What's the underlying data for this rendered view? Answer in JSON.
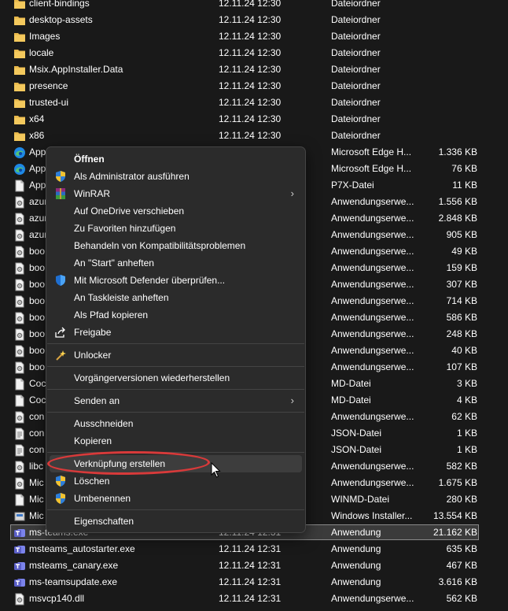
{
  "files": [
    {
      "name": "client-bindings",
      "date": "12.11.24 12:30",
      "type": "Dateiordner",
      "size": "",
      "icon": "folder-icon"
    },
    {
      "name": "desktop-assets",
      "date": "12.11.24 12:30",
      "type": "Dateiordner",
      "size": "",
      "icon": "folder-icon"
    },
    {
      "name": "Images",
      "date": "12.11.24 12:30",
      "type": "Dateiordner",
      "size": "",
      "icon": "folder-icon"
    },
    {
      "name": "locale",
      "date": "12.11.24 12:30",
      "type": "Dateiordner",
      "size": "",
      "icon": "folder-icon"
    },
    {
      "name": "Msix.AppInstaller.Data",
      "date": "12.11.24 12:30",
      "type": "Dateiordner",
      "size": "",
      "icon": "folder-icon"
    },
    {
      "name": "presence",
      "date": "12.11.24 12:30",
      "type": "Dateiordner",
      "size": "",
      "icon": "folder-icon"
    },
    {
      "name": "trusted-ui",
      "date": "12.11.24 12:30",
      "type": "Dateiordner",
      "size": "",
      "icon": "folder-icon"
    },
    {
      "name": "x64",
      "date": "12.11.24 12:30",
      "type": "Dateiordner",
      "size": "",
      "icon": "folder-icon"
    },
    {
      "name": "x86",
      "date": "12.11.24 12:30",
      "type": "Dateiordner",
      "size": "",
      "icon": "folder-icon"
    },
    {
      "name": "App",
      "date": "",
      "type": "Microsoft Edge H...",
      "size": "1.336 KB",
      "icon": "edge-icon"
    },
    {
      "name": "App",
      "date": "",
      "type": "Microsoft Edge H...",
      "size": "76 KB",
      "icon": "edge-icon"
    },
    {
      "name": "App",
      "date": "",
      "type": "P7X-Datei",
      "size": "11 KB",
      "icon": "file-icon"
    },
    {
      "name": "azur",
      "date": "",
      "type": "Anwendungserwe...",
      "size": "1.556 KB",
      "icon": "dll-icon"
    },
    {
      "name": "azur",
      "date": "",
      "type": "Anwendungserwe...",
      "size": "2.848 KB",
      "icon": "dll-icon"
    },
    {
      "name": "azur",
      "date": "",
      "type": "Anwendungserwe...",
      "size": "905 KB",
      "icon": "dll-icon"
    },
    {
      "name": "boo",
      "date": "",
      "type": "Anwendungserwe...",
      "size": "49 KB",
      "icon": "dll-icon"
    },
    {
      "name": "boo",
      "date": "",
      "type": "Anwendungserwe...",
      "size": "159 KB",
      "icon": "dll-icon"
    },
    {
      "name": "boo",
      "date": "",
      "type": "Anwendungserwe...",
      "size": "307 KB",
      "icon": "dll-icon"
    },
    {
      "name": "boo",
      "date": "",
      "type": "Anwendungserwe...",
      "size": "714 KB",
      "icon": "dll-icon"
    },
    {
      "name": "boo",
      "date": "",
      "type": "Anwendungserwe...",
      "size": "586 KB",
      "icon": "dll-icon"
    },
    {
      "name": "boo",
      "date": "",
      "type": "Anwendungserwe...",
      "size": "248 KB",
      "icon": "dll-icon"
    },
    {
      "name": "boo",
      "date": "",
      "type": "Anwendungserwe...",
      "size": "40 KB",
      "icon": "dll-icon"
    },
    {
      "name": "boo",
      "date": "",
      "type": "Anwendungserwe...",
      "size": "107 KB",
      "icon": "dll-icon"
    },
    {
      "name": "Coc",
      "date": "",
      "type": "MD-Datei",
      "size": "3 KB",
      "icon": "file-icon"
    },
    {
      "name": "Coc",
      "date": "",
      "type": "MD-Datei",
      "size": "4 KB",
      "icon": "file-icon"
    },
    {
      "name": "con",
      "date": "",
      "type": "Anwendungserwe...",
      "size": "62 KB",
      "icon": "dll-icon"
    },
    {
      "name": "con",
      "date": "",
      "type": "JSON-Datei",
      "size": "1 KB",
      "icon": "text-file-icon"
    },
    {
      "name": "con",
      "date": "",
      "type": "JSON-Datei",
      "size": "1 KB",
      "icon": "text-file-icon"
    },
    {
      "name": "libc",
      "date": "",
      "type": "Anwendungserwe...",
      "size": "582 KB",
      "icon": "dll-icon"
    },
    {
      "name": "Mic",
      "date": "",
      "type": "Anwendungserwe...",
      "size": "1.675 KB",
      "icon": "dll-icon"
    },
    {
      "name": "Mic",
      "date": "",
      "type": "WINMD-Datei",
      "size": "280 KB",
      "icon": "file-icon"
    },
    {
      "name": "Mic",
      "date": "",
      "type": "Windows Installer...",
      "size": "13.554 KB",
      "icon": "installer-icon"
    },
    {
      "name": "ms-teams.exe",
      "date": "12.11.24 12:31",
      "type": "Anwendung",
      "size": "21.162 KB",
      "icon": "teams-icon",
      "selected": true
    },
    {
      "name": "msteams_autostarter.exe",
      "date": "12.11.24 12:31",
      "type": "Anwendung",
      "size": "635 KB",
      "icon": "teams-icon"
    },
    {
      "name": "msteams_canary.exe",
      "date": "12.11.24 12:31",
      "type": "Anwendung",
      "size": "467 KB",
      "icon": "teams-icon"
    },
    {
      "name": "ms-teamsupdate.exe",
      "date": "12.11.24 12:31",
      "type": "Anwendung",
      "size": "3.616 KB",
      "icon": "teams-icon"
    },
    {
      "name": "msvcp140.dll",
      "date": "12.11.24 12:31",
      "type": "Anwendungserwe...",
      "size": "562 KB",
      "icon": "dll-icon"
    }
  ],
  "context_menu": {
    "items": [
      {
        "label": "Öffnen",
        "bold": true,
        "icon": ""
      },
      {
        "label": "Als Administrator ausführen",
        "icon": "uac-shield-icon"
      },
      {
        "label": "WinRAR",
        "icon": "winrar-icon",
        "submenu": true
      },
      {
        "label": "Auf OneDrive verschieben",
        "icon": ""
      },
      {
        "label": "Zu Favoriten hinzufügen",
        "icon": ""
      },
      {
        "label": "Behandeln von Kompatibilitätsproblemen",
        "icon": ""
      },
      {
        "label": "An \"Start\" anheften",
        "icon": ""
      },
      {
        "label": "Mit Microsoft Defender überprüfen...",
        "icon": "defender-icon"
      },
      {
        "label": "An Taskleiste anheften",
        "icon": ""
      },
      {
        "label": "Als Pfad kopieren",
        "icon": ""
      },
      {
        "label": "Freigabe",
        "icon": "share-icon"
      },
      {
        "separator": true
      },
      {
        "label": "Unlocker",
        "icon": "unlocker-icon"
      },
      {
        "separator": true
      },
      {
        "label": "Vorgängerversionen wiederherstellen",
        "icon": ""
      },
      {
        "separator": true
      },
      {
        "label": "Senden an",
        "icon": "",
        "submenu": true
      },
      {
        "separator": true
      },
      {
        "label": "Ausschneiden",
        "icon": ""
      },
      {
        "label": "Kopieren",
        "icon": ""
      },
      {
        "separator": true
      },
      {
        "label": "Verknüpfung erstellen",
        "icon": "",
        "hover": true
      },
      {
        "label": "Löschen",
        "icon": "uac-shield-icon"
      },
      {
        "label": "Umbenennen",
        "icon": "uac-shield-icon"
      },
      {
        "separator": true
      },
      {
        "label": "Eigenschaften",
        "icon": ""
      }
    ],
    "submenu_arrow": "›"
  },
  "colors": {
    "background": "#191919",
    "menu_background": "#2b2b2b",
    "annotation": "#d83a3a",
    "folder": "#e8b84a",
    "teams": "#5b5fc7"
  }
}
